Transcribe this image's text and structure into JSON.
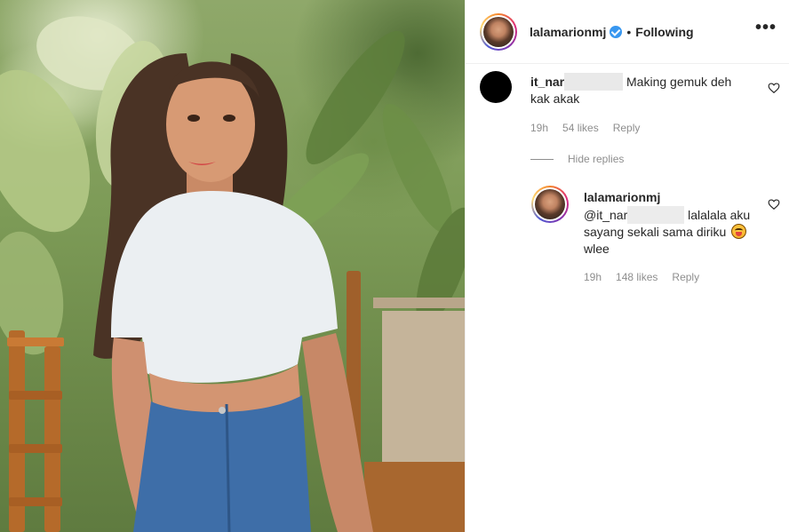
{
  "header": {
    "username": "lalamarionmj",
    "separator": "•",
    "follow_status": "Following",
    "more_icon": "more-horizontal-icon"
  },
  "comments": [
    {
      "username": "it_nar",
      "text": "Making gemuk deh kak akak",
      "time": "19h",
      "likes": "54 likes",
      "reply_label": "Reply"
    }
  ],
  "hide_replies_label": "Hide replies",
  "reply": {
    "username": "lalamarionmj",
    "mention": "@it_nar",
    "text_1": "lalalala aku sayang sekali sama diriku",
    "text_2": "wlee",
    "time": "19h",
    "likes": "148 likes",
    "reply_label": "Reply"
  },
  "colors": {
    "verified": "#3897f0",
    "meta_gray": "#8e8e8e",
    "text": "#262626"
  }
}
